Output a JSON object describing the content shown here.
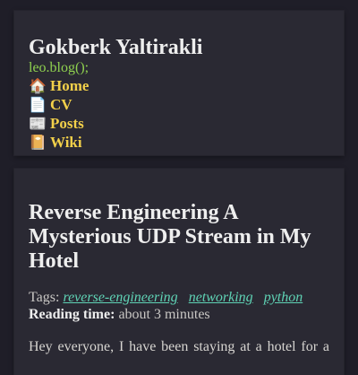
{
  "header": {
    "site_title": "Gokberk Yaltirakli",
    "tagline": "leo.blog();",
    "nav": [
      {
        "icon": "🏠",
        "icon_name": "house-icon",
        "label": "Home"
      },
      {
        "icon": "📄",
        "icon_name": "document-icon",
        "label": "CV"
      },
      {
        "icon": "📰",
        "icon_name": "newspaper-icon",
        "label": "Posts"
      },
      {
        "icon": "📔",
        "icon_name": "notebook-icon",
        "label": "Wiki"
      }
    ]
  },
  "post": {
    "title": "Reverse Engineering A Mysterious UDP Stream in My Hotel",
    "tags_label": "Tags:",
    "tags": [
      "reverse-engineering",
      "networking",
      "python"
    ],
    "reading_time_label": "Reading time:",
    "reading_time_value": "about 3 minutes",
    "body_start": "Hey everyone, I have been staying at a hotel for a"
  },
  "colors": {
    "background": "#1f1e28",
    "card": "#2a2933",
    "nav_link": "#f2d04a",
    "tagline": "#8fd14f",
    "tag_link": "#5fd3b5"
  }
}
